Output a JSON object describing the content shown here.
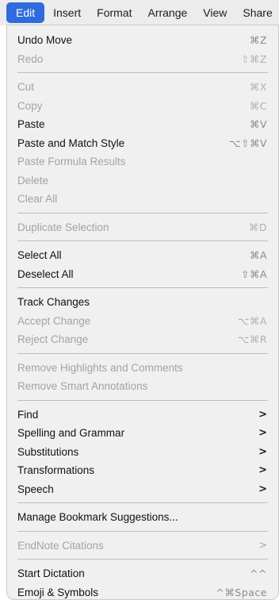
{
  "menubar": {
    "items": [
      {
        "label": "Edit",
        "active": true
      },
      {
        "label": "Insert"
      },
      {
        "label": "Format"
      },
      {
        "label": "Arrange"
      },
      {
        "label": "View"
      },
      {
        "label": "Share"
      }
    ]
  },
  "menu": {
    "groups": [
      [
        {
          "id": "undo-move",
          "label": "Undo Move",
          "shortcut": "⌘Z",
          "enabled": true
        },
        {
          "id": "redo",
          "label": "Redo",
          "shortcut": "⇧⌘Z",
          "enabled": false
        }
      ],
      [
        {
          "id": "cut",
          "label": "Cut",
          "shortcut": "⌘X",
          "enabled": false
        },
        {
          "id": "copy",
          "label": "Copy",
          "shortcut": "⌘C",
          "enabled": false
        },
        {
          "id": "paste",
          "label": "Paste",
          "shortcut": "⌘V",
          "enabled": true
        },
        {
          "id": "paste-and-match-style",
          "label": "Paste and Match Style",
          "shortcut": "⌥⇧⌘V",
          "enabled": true
        },
        {
          "id": "paste-formula-results",
          "label": "Paste Formula Results",
          "shortcut": "",
          "enabled": false
        },
        {
          "id": "delete",
          "label": "Delete",
          "shortcut": "",
          "enabled": false
        },
        {
          "id": "clear-all",
          "label": "Clear All",
          "shortcut": "",
          "enabled": false
        }
      ],
      [
        {
          "id": "duplicate-selection",
          "label": "Duplicate Selection",
          "shortcut": "⌘D",
          "enabled": false
        }
      ],
      [
        {
          "id": "select-all",
          "label": "Select All",
          "shortcut": "⌘A",
          "enabled": true
        },
        {
          "id": "deselect-all",
          "label": "Deselect All",
          "shortcut": "⇧⌘A",
          "enabled": true
        }
      ],
      [
        {
          "id": "track-changes",
          "label": "Track Changes",
          "shortcut": "",
          "enabled": true
        },
        {
          "id": "accept-change",
          "label": "Accept Change",
          "shortcut": "⌥⌘A",
          "enabled": false
        },
        {
          "id": "reject-change",
          "label": "Reject Change",
          "shortcut": "⌥⌘R",
          "enabled": false
        }
      ],
      [
        {
          "id": "remove-highlights-and-comments",
          "label": "Remove Highlights and Comments",
          "shortcut": "",
          "enabled": false
        },
        {
          "id": "remove-smart-annotations",
          "label": "Remove Smart Annotations",
          "shortcut": "",
          "enabled": false
        }
      ],
      [
        {
          "id": "find",
          "label": "Find",
          "submenu": true,
          "enabled": true
        },
        {
          "id": "spelling-and-grammar",
          "label": "Spelling and Grammar",
          "submenu": true,
          "enabled": true
        },
        {
          "id": "substitutions",
          "label": "Substitutions",
          "submenu": true,
          "enabled": true
        },
        {
          "id": "transformations",
          "label": "Transformations",
          "submenu": true,
          "enabled": true
        },
        {
          "id": "speech",
          "label": "Speech",
          "submenu": true,
          "enabled": true
        }
      ],
      [
        {
          "id": "manage-bookmark-suggestions",
          "label": "Manage Bookmark Suggestions...",
          "shortcut": "",
          "enabled": true
        }
      ],
      [
        {
          "id": "endnote-citations",
          "label": "EndNote Citations",
          "submenu": true,
          "enabled": false
        }
      ],
      [
        {
          "id": "start-dictation",
          "label": "Start Dictation",
          "shortcut": "^^",
          "enabled": true
        },
        {
          "id": "emoji-and-symbols",
          "label": "Emoji & Symbols",
          "shortcut": "^⌘Space",
          "enabled": true
        }
      ]
    ],
    "chevron_glyph": ">"
  },
  "colors": {
    "accent": "#2f6bdc",
    "menubar_bg": "#ececec",
    "menu_bg": "#f0f0f0",
    "text": "#111111",
    "disabled_text": "#a3a3a3",
    "separator": "#bcbcbc"
  },
  "icons": {
    "submenu": "chevron-right-icon"
  }
}
